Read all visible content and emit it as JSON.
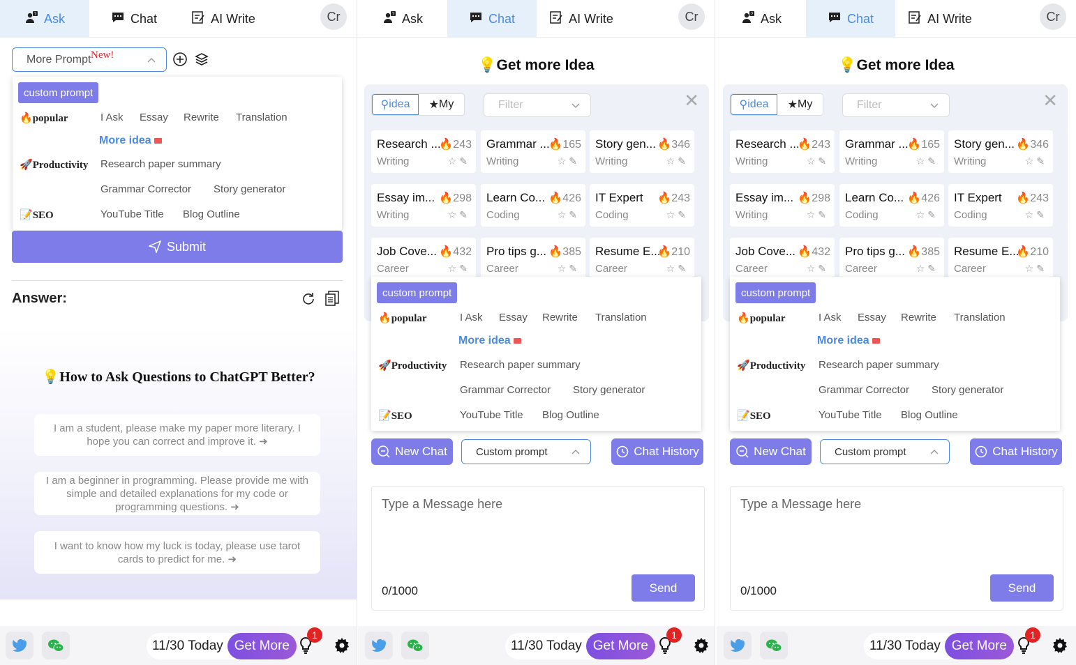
{
  "tabs": {
    "ask": "Ask",
    "chat": "Chat",
    "ai_write": "AI Write"
  },
  "avatar": "Cr",
  "colors": {
    "accent": "#7e7ce8",
    "blue": "#4a8ae0",
    "active_tab_bg": "#e6f0fb",
    "fire": "#e8632a",
    "badge": "#e02424"
  },
  "ask_panel": {
    "prompt_select": "More Prompt",
    "new_tag": "New!",
    "submit": "Submit",
    "answer_label": "Answer:",
    "howto_title": "How to Ask Questions to ChatGPT Better?",
    "questions": [
      "I am a student, please make my paper more literary. I hope you can correct and improve it. ➜",
      "I am a beginner in programming. Please provide me with simple and detailed explanations for my code or programming questions. ➜",
      "I want to know how my luck is today, please use tarot cards to predict for me. ➜"
    ]
  },
  "prompt_menu": {
    "custom_prompt": "custom prompt",
    "popular": "popular",
    "popular_items": [
      "I Ask",
      "Essay",
      "Rewrite",
      "Translation"
    ],
    "more_idea": "More idea",
    "productivity": "Productivity",
    "productivity_items": [
      "Research paper summary",
      "Grammar Corrector",
      "Story generator"
    ],
    "seo": "SEO",
    "seo_items": [
      "YouTube Title",
      "Blog Outline"
    ]
  },
  "chat_panel": {
    "get_idea_title": "Get more Idea",
    "seg_idea": "idea",
    "seg_my": "My",
    "filter_placeholder": "Filter",
    "close": "✕",
    "cards": [
      {
        "title": "Research ...",
        "count": "243",
        "cat": "Writing"
      },
      {
        "title": "Grammar ...",
        "count": "165",
        "cat": "Writing"
      },
      {
        "title": "Story gen...",
        "count": "346",
        "cat": "Writing"
      },
      {
        "title": "Essay im...",
        "count": "298",
        "cat": "Writing"
      },
      {
        "title": "Learn Co...",
        "count": "426",
        "cat": "Coding"
      },
      {
        "title": "IT Expert",
        "count": "243",
        "cat": "Coding"
      },
      {
        "title": "Job Cove...",
        "count": "432",
        "cat": "Career"
      },
      {
        "title": "Pro tips g...",
        "count": "385",
        "cat": "Career"
      },
      {
        "title": "Resume E...",
        "count": "210",
        "cat": "Career"
      }
    ],
    "new_chat": "New Chat",
    "custom_prompt_select": "Custom prompt",
    "chat_history": "Chat History",
    "message_placeholder": "Type a Message here",
    "counter": "0/1000",
    "send": "Send"
  },
  "footer": {
    "quota": "11/30 Today",
    "get_more": "Get More",
    "badge_count": "1"
  }
}
